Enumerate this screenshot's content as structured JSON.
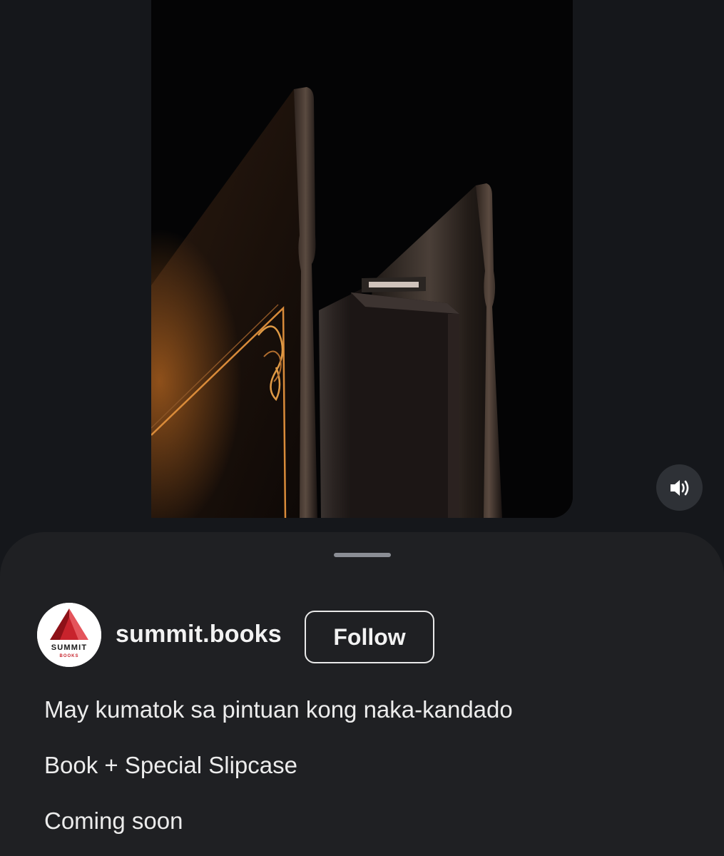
{
  "media": {
    "description_icon": "video-frame",
    "sound_icon": "speaker-volume-icon"
  },
  "profile": {
    "username": "summit.books",
    "avatar_logo_text": "SUMMIT",
    "avatar_logo_subtext": "BOOKS",
    "follow_label": "Follow"
  },
  "caption": {
    "lines": [
      "May kumatok sa pintuan kong naka-kandado",
      "Book + Special Slipcase",
      "Coming soon"
    ]
  },
  "colors": {
    "background": "#15171b",
    "sheet": "#1f2023",
    "accent_gold": "#d98b3a",
    "logo_red": "#c8232c"
  }
}
